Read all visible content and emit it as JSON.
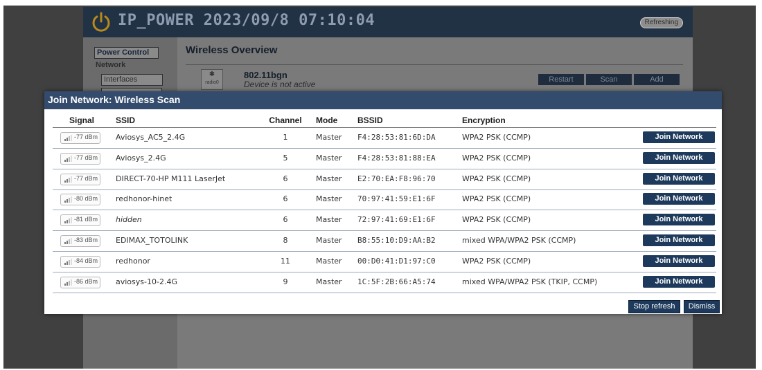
{
  "header": {
    "title": "IP_POWER 2023/09/8 07:10:04",
    "status_badge": "Refreshing"
  },
  "sidebar": {
    "power_control": "Power Control",
    "section_network": "Network",
    "interfaces": "Interfaces"
  },
  "background_page": {
    "heading": "Wireless Overview",
    "radio_icon_label": "radio0",
    "radio_mode": "802.11bgn",
    "radio_status": "Device is not active",
    "buttons": {
      "restart": "Restart",
      "scan": "Scan",
      "add": "Add"
    }
  },
  "modal": {
    "title": "Join Network: Wireless Scan",
    "columns": {
      "signal": "Signal",
      "ssid": "SSID",
      "channel": "Channel",
      "mode": "Mode",
      "bssid": "BSSID",
      "encryption": "Encryption"
    },
    "rows": [
      {
        "signal": "-77 dBm",
        "ssid": "Aviosys_AC5_2.4G",
        "channel": "1",
        "mode": "Master",
        "bssid": "F4:28:53:81:6D:DA",
        "encryption": "WPA2 PSK (CCMP)",
        "join_label": "Join Network"
      },
      {
        "signal": "-77 dBm",
        "ssid": "Aviosys_2.4G",
        "channel": "5",
        "mode": "Master",
        "bssid": "F4:28:53:81:88:EA",
        "encryption": "WPA2 PSK (CCMP)",
        "join_label": "Join Network"
      },
      {
        "signal": "-77 dBm",
        "ssid": "DIRECT-70-HP M111 LaserJet",
        "channel": "6",
        "mode": "Master",
        "bssid": "E2:70:EA:F8:96:70",
        "encryption": "WPA2 PSK (CCMP)",
        "join_label": "Join Network"
      },
      {
        "signal": "-80 dBm",
        "ssid": "redhonor-hinet",
        "channel": "6",
        "mode": "Master",
        "bssid": "70:97:41:59:E1:6F",
        "encryption": "WPA2 PSK (CCMP)",
        "join_label": "Join Network"
      },
      {
        "signal": "-81 dBm",
        "ssid": "hidden",
        "channel": "6",
        "mode": "Master",
        "bssid": "72:97:41:69:E1:6F",
        "encryption": "WPA2 PSK (CCMP)",
        "join_label": "Join Network"
      },
      {
        "signal": "-83 dBm",
        "ssid": "EDIMAX_TOTOLINK",
        "channel": "8",
        "mode": "Master",
        "bssid": "B8:55:10:D9:AA:B2",
        "encryption": "mixed WPA/WPA2 PSK (CCMP)",
        "join_label": "Join Network"
      },
      {
        "signal": "-84 dBm",
        "ssid": "redhonor",
        "channel": "11",
        "mode": "Master",
        "bssid": "00:D0:41:D1:97:C0",
        "encryption": "WPA2 PSK (CCMP)",
        "join_label": "Join Network"
      },
      {
        "signal": "-86 dBm",
        "ssid": "aviosys-10-2.4G",
        "channel": "9",
        "mode": "Master",
        "bssid": "1C:5F:2B:66:A5:74",
        "encryption": "mixed WPA/WPA2 PSK (TKIP, CCMP)",
        "join_label": "Join Network"
      }
    ],
    "footer": {
      "stop_refresh": "Stop refresh",
      "dismiss": "Dismiss"
    }
  },
  "icons": {
    "power": "power-icon",
    "signal": "signal-strength-icon",
    "radio": "wifi-antenna-icon"
  },
  "colors": {
    "header_bg": "#213244",
    "modal_header_bg": "#334b6d",
    "button_bg": "#1d3a5c",
    "row_divider": "#9aa7b8"
  }
}
